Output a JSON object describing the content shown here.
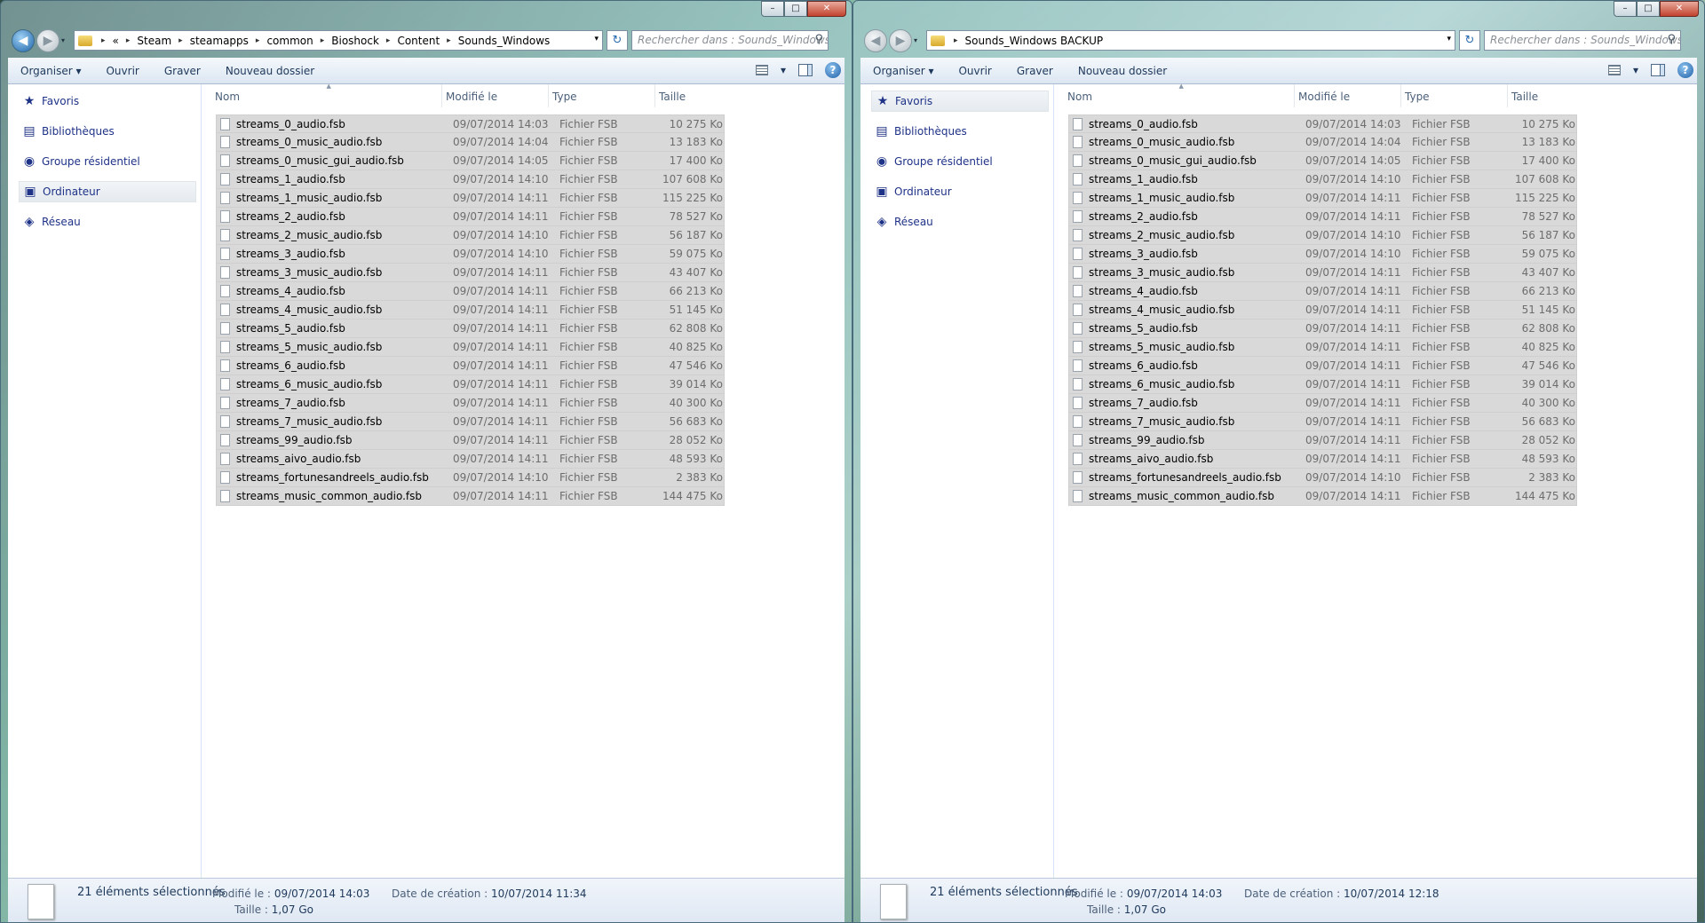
{
  "windows": [
    {
      "caption": {
        "min": "–",
        "max": "□",
        "close": "✕"
      },
      "breadcrumbs": [
        "«",
        "Steam",
        "steamapps",
        "common",
        "Bioshock",
        "Content",
        "Sounds_Windows"
      ],
      "search_placeholder": "Rechercher dans : Sounds_Windows",
      "toolbar": {
        "organize": "Organiser ▾",
        "open": "Ouvrir",
        "burn": "Graver",
        "new_folder": "Nouveau dossier"
      },
      "nav": [
        {
          "label": "Favoris",
          "icon": "star-icon",
          "glyph": "★"
        },
        {
          "label": "Bibliothèques",
          "icon": "library-icon",
          "glyph": "▤"
        },
        {
          "label": "Groupe résidentiel",
          "icon": "homegroup-icon",
          "glyph": "◉"
        },
        {
          "label": "Ordinateur",
          "icon": "computer-icon",
          "glyph": "▣"
        },
        {
          "label": "Réseau",
          "icon": "network-icon",
          "glyph": "◈"
        }
      ],
      "selected_nav": 3,
      "status": {
        "count": "21 éléments sélectionnés",
        "modified_label": "Modifié le :",
        "modified": "09/07/2014 14:03",
        "created_label": "Date de création :",
        "created": "10/07/2014 11:34",
        "size_label": "Taille :",
        "size": "1,07 Go"
      }
    },
    {
      "caption": {
        "min": "–",
        "max": "□",
        "close": "✕"
      },
      "breadcrumbs": [
        "Sounds_Windows BACKUP"
      ],
      "search_placeholder": "Rechercher dans : Sounds_Windows B...",
      "toolbar": {
        "organize": "Organiser ▾",
        "open": "Ouvrir",
        "burn": "Graver",
        "new_folder": "Nouveau dossier"
      },
      "nav": [
        {
          "label": "Favoris",
          "icon": "star-icon",
          "glyph": "★"
        },
        {
          "label": "Bibliothèques",
          "icon": "library-icon",
          "glyph": "▤"
        },
        {
          "label": "Groupe résidentiel",
          "icon": "homegroup-icon",
          "glyph": "◉"
        },
        {
          "label": "Ordinateur",
          "icon": "computer-icon",
          "glyph": "▣"
        },
        {
          "label": "Réseau",
          "icon": "network-icon",
          "glyph": "◈"
        }
      ],
      "selected_nav": 0,
      "status": {
        "count": "21 éléments sélectionnés",
        "modified_label": "Modifié le :",
        "modified": "09/07/2014 14:03",
        "created_label": "Date de création :",
        "created": "10/07/2014 12:18",
        "size_label": "Taille :",
        "size": "1,07 Go"
      }
    }
  ],
  "columns": {
    "name": "Nom",
    "modified": "Modifié le",
    "type": "Type",
    "size": "Taille"
  },
  "files": [
    {
      "name": "streams_0_audio.fsb",
      "date": "09/07/2014 14:03",
      "type": "Fichier FSB",
      "size": "10 275 Ko"
    },
    {
      "name": "streams_0_music_audio.fsb",
      "date": "09/07/2014 14:04",
      "type": "Fichier FSB",
      "size": "13 183 Ko"
    },
    {
      "name": "streams_0_music_gui_audio.fsb",
      "date": "09/07/2014 14:05",
      "type": "Fichier FSB",
      "size": "17 400 Ko"
    },
    {
      "name": "streams_1_audio.fsb",
      "date": "09/07/2014 14:10",
      "type": "Fichier FSB",
      "size": "107 608 Ko"
    },
    {
      "name": "streams_1_music_audio.fsb",
      "date": "09/07/2014 14:11",
      "type": "Fichier FSB",
      "size": "115 225 Ko"
    },
    {
      "name": "streams_2_audio.fsb",
      "date": "09/07/2014 14:11",
      "type": "Fichier FSB",
      "size": "78 527 Ko"
    },
    {
      "name": "streams_2_music_audio.fsb",
      "date": "09/07/2014 14:10",
      "type": "Fichier FSB",
      "size": "56 187 Ko"
    },
    {
      "name": "streams_3_audio.fsb",
      "date": "09/07/2014 14:10",
      "type": "Fichier FSB",
      "size": "59 075 Ko"
    },
    {
      "name": "streams_3_music_audio.fsb",
      "date": "09/07/2014 14:11",
      "type": "Fichier FSB",
      "size": "43 407 Ko"
    },
    {
      "name": "streams_4_audio.fsb",
      "date": "09/07/2014 14:11",
      "type": "Fichier FSB",
      "size": "66 213 Ko"
    },
    {
      "name": "streams_4_music_audio.fsb",
      "date": "09/07/2014 14:11",
      "type": "Fichier FSB",
      "size": "51 145 Ko"
    },
    {
      "name": "streams_5_audio.fsb",
      "date": "09/07/2014 14:11",
      "type": "Fichier FSB",
      "size": "62 808 Ko"
    },
    {
      "name": "streams_5_music_audio.fsb",
      "date": "09/07/2014 14:11",
      "type": "Fichier FSB",
      "size": "40 825 Ko"
    },
    {
      "name": "streams_6_audio.fsb",
      "date": "09/07/2014 14:11",
      "type": "Fichier FSB",
      "size": "47 546 Ko"
    },
    {
      "name": "streams_6_music_audio.fsb",
      "date": "09/07/2014 14:11",
      "type": "Fichier FSB",
      "size": "39 014 Ko"
    },
    {
      "name": "streams_7_audio.fsb",
      "date": "09/07/2014 14:11",
      "type": "Fichier FSB",
      "size": "40 300 Ko"
    },
    {
      "name": "streams_7_music_audio.fsb",
      "date": "09/07/2014 14:11",
      "type": "Fichier FSB",
      "size": "56 683 Ko"
    },
    {
      "name": "streams_99_audio.fsb",
      "date": "09/07/2014 14:11",
      "type": "Fichier FSB",
      "size": "28 052 Ko"
    },
    {
      "name": "streams_aivo_audio.fsb",
      "date": "09/07/2014 14:11",
      "type": "Fichier FSB",
      "size": "48 593 Ko"
    },
    {
      "name": "streams_fortunesandreels_audio.fsb",
      "date": "09/07/2014 14:10",
      "type": "Fichier FSB",
      "size": "2 383 Ko"
    },
    {
      "name": "streams_music_common_audio.fsb",
      "date": "09/07/2014 14:11",
      "type": "Fichier FSB",
      "size": "144 475 Ko"
    }
  ],
  "icons": {
    "back": "◀",
    "forward": "▶",
    "dropdown": "▾",
    "crumb_sep": "▸",
    "refresh": "↻",
    "search": "⚲",
    "help": "?"
  },
  "colors": {
    "selection": "#d9d9d9",
    "link": "#1e3287",
    "accent": "#1e63a8"
  }
}
